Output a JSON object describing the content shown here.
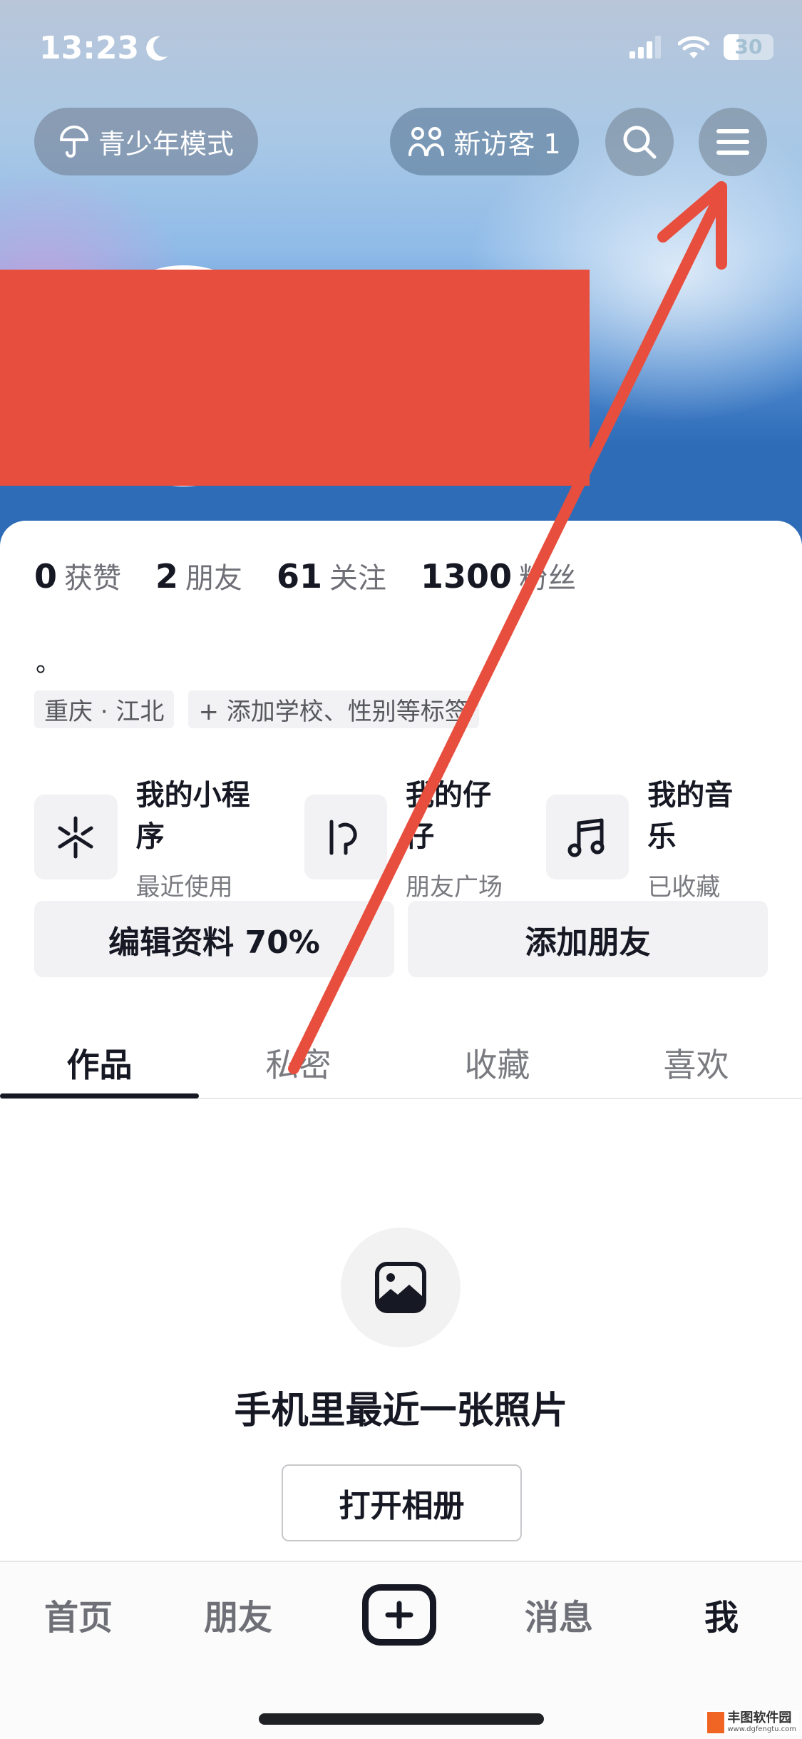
{
  "status_bar": {
    "time": "13:23",
    "focus_icon": "moon-icon",
    "battery": "30"
  },
  "header": {
    "youth_mode_label": "青少年模式",
    "visitors_label": "新访客 1",
    "search_icon": "search-icon",
    "menu_icon": "menu-icon"
  },
  "profile": {
    "stats": [
      {
        "value": "0",
        "label": "获赞"
      },
      {
        "value": "2",
        "label": "朋友"
      },
      {
        "value": "61",
        "label": "关注"
      },
      {
        "value": "1300",
        "label": "粉丝"
      }
    ],
    "bio": "。",
    "tags": [
      {
        "label": "重庆 · 江北"
      },
      {
        "label": "+ 添加学校、性别等标签"
      }
    ],
    "shortcuts": [
      {
        "title": "我的小程序",
        "subtitle": "最近使用",
        "icon": "mini-program-icon"
      },
      {
        "title": "我的仔仔",
        "subtitle": "朋友广场",
        "icon": "zaizai-icon"
      },
      {
        "title": "我的音乐",
        "subtitle": "已收藏",
        "icon": "music-note-icon"
      }
    ],
    "edit_profile_label": "编辑资料 70%",
    "add_friend_label": "添加朋友"
  },
  "tabs": [
    {
      "label": "作品",
      "active": true
    },
    {
      "label": "私密",
      "active": false
    },
    {
      "label": "收藏",
      "active": false
    },
    {
      "label": "喜欢",
      "active": false
    }
  ],
  "empty_state": {
    "title": "手机里最近一张照片",
    "button_label": "打开相册"
  },
  "bottom_nav": {
    "items": [
      {
        "label": "首页"
      },
      {
        "label": "朋友"
      },
      {
        "label": "消息"
      },
      {
        "label": "我",
        "active": true
      }
    ]
  },
  "watermark": {
    "name": "丰图软件园",
    "url": "www.dgfengtu.com"
  },
  "annotation_color": "#e84e3d"
}
